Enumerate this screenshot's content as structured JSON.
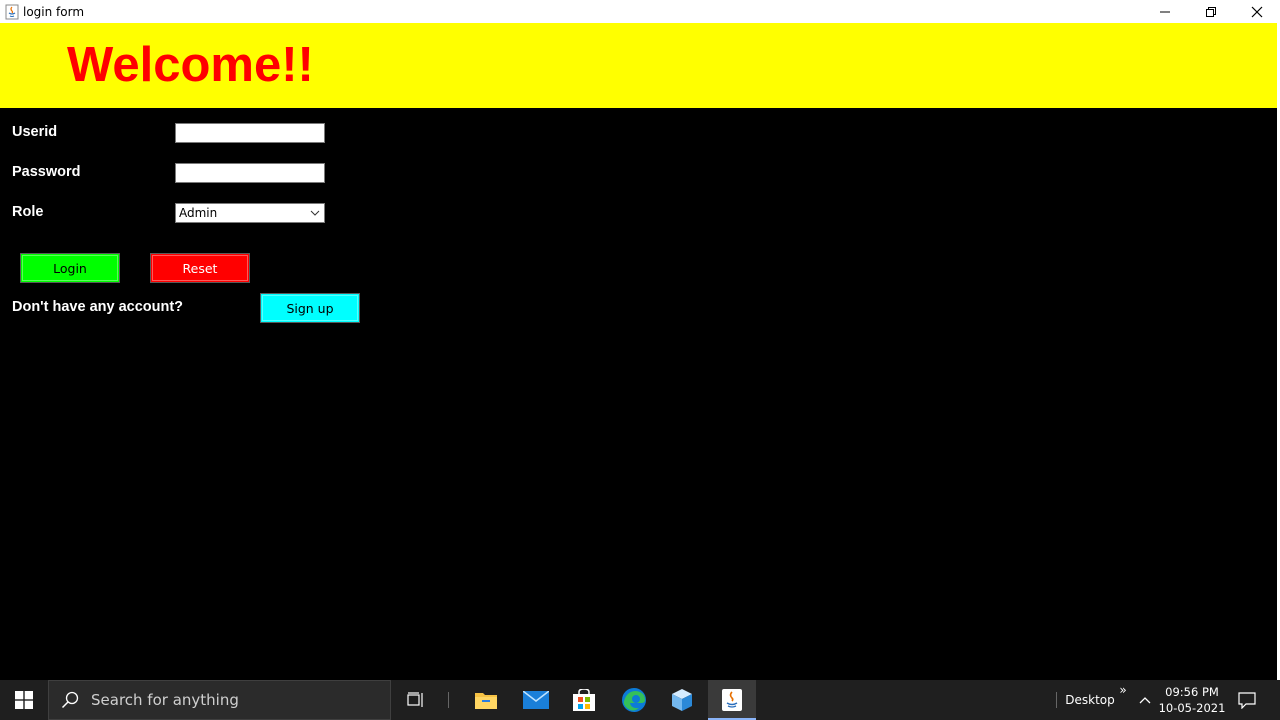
{
  "window": {
    "title": "login form",
    "controls": [
      "minimize-icon",
      "restore-icon",
      "close-icon"
    ]
  },
  "header": {
    "welcome_text": "Welcome!!",
    "background_color": "#ffff00",
    "text_color": "#ff0000"
  },
  "form": {
    "userid_label": "Userid",
    "userid_value": "",
    "password_label": "Password",
    "password_value": "",
    "role_label": "Role",
    "role_selected": "Admin",
    "login_label": "Login",
    "reset_label": "Reset",
    "no_account_text": "Don't have any account?",
    "signup_label": "Sign up"
  },
  "colors": {
    "login": "#00ff00",
    "reset": "#ff0000",
    "signup": "#00ffff"
  },
  "taskbar": {
    "search_placeholder": "Search for anything",
    "desktop_label": "Desktop",
    "time": "09:56 PM",
    "date": "10-05-2021",
    "icons": [
      "windows-start-icon",
      "search-icon",
      "task-view-icon",
      "file-explorer-icon",
      "mail-icon",
      "store-icon",
      "edge-icon",
      "3d-box-icon",
      "java-icon",
      "chevron-up-icon",
      "notification-icon"
    ]
  }
}
